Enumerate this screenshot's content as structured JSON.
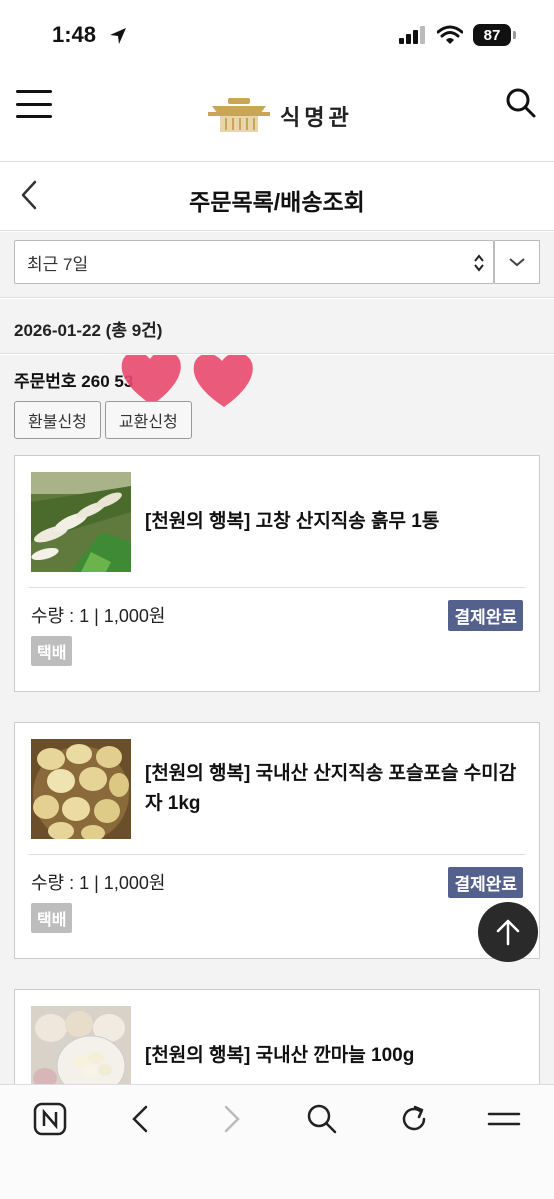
{
  "status": {
    "time": "1:48",
    "battery": "87"
  },
  "header": {
    "logo_text": "식명관"
  },
  "page": {
    "title": "주문목록/배송조회"
  },
  "filter": {
    "period": "최근 7일"
  },
  "order_group": {
    "date_label": "2026-01-22 (총 9건)",
    "order_number": "주문번호 260      53",
    "refund_label": "환불신청",
    "exchange_label": "교환신청"
  },
  "products": [
    {
      "name": "[천원의 행복] 고창 산지직송 흙무 1통",
      "qty_price": "수량 : 1 | 1,000원",
      "status": "결제완료",
      "delivery": "택배"
    },
    {
      "name": "[천원의 행복] 국내산 산지직송 포슬포슬 수미감자 1kg",
      "qty_price": "수량 : 1 | 1,000원",
      "status": "결제완료",
      "delivery": "택배"
    },
    {
      "name": "[천원의 행복] 국내산 깐마늘 100g"
    }
  ],
  "colors": {
    "status_badge": "#55618d",
    "delivery_badge": "#bdbdbd",
    "heart": "#e94a6e"
  },
  "icons": [
    "location-arrow-icon",
    "signal-icon",
    "wifi-icon",
    "battery-icon",
    "menu-icon",
    "logo-icon",
    "search-icon",
    "back-icon",
    "updown-icon",
    "chevron-down-icon",
    "heart-icon",
    "arrow-up-icon",
    "naver-icon",
    "reload-icon",
    "tabs-icon"
  ]
}
